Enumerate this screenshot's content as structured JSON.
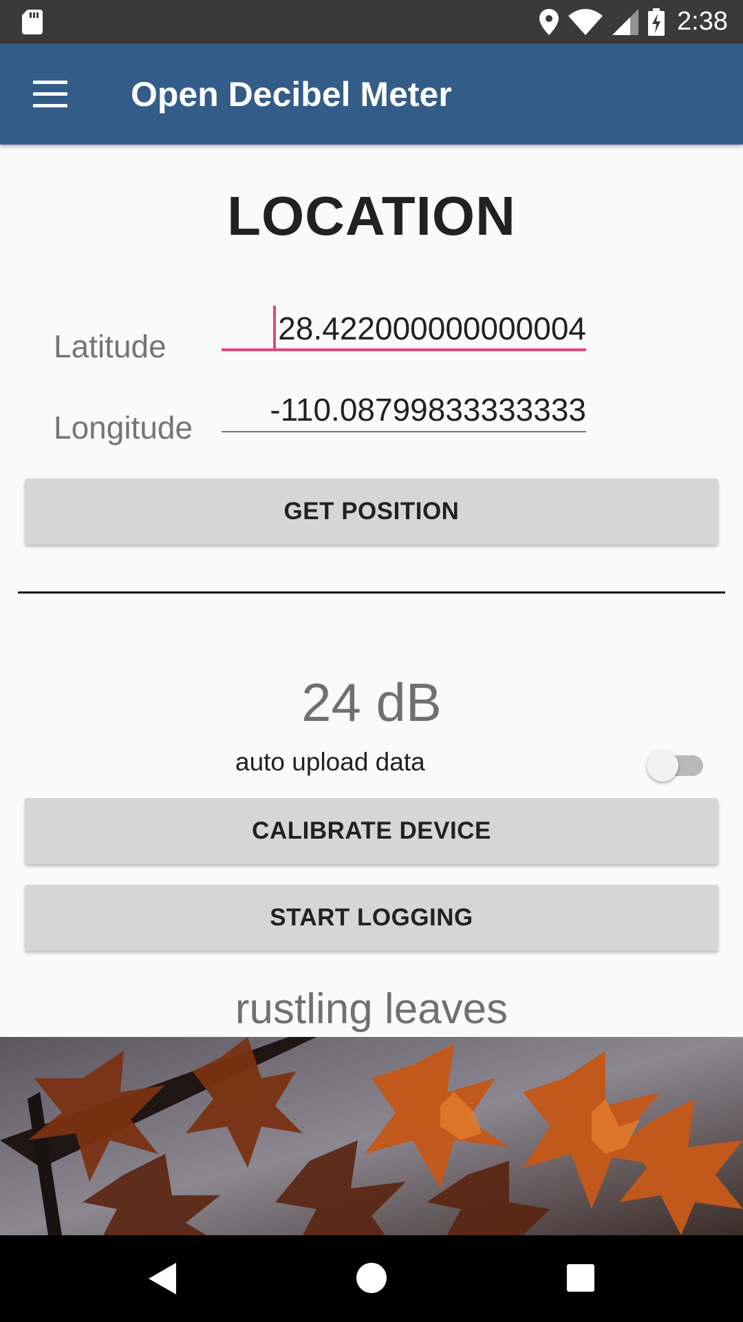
{
  "status_bar": {
    "time": "2:38",
    "icons": [
      "sd-card-icon",
      "location-icon",
      "wifi-icon",
      "signal-icon",
      "battery-charging-icon"
    ]
  },
  "app_bar": {
    "title": "Open Decibel Meter",
    "menu_icon": "menu-icon"
  },
  "location": {
    "title": "LOCATION",
    "latitude_label": "Latitude",
    "latitude_value": "28.422000000000004",
    "longitude_label": "Longitude",
    "longitude_value": "-110.08799833333333",
    "get_position_label": "GET POSITION"
  },
  "meter": {
    "reading": "24 dB",
    "auto_upload_label": "auto upload data",
    "auto_upload_enabled": false,
    "calibrate_label": "CALIBRATE DEVICE",
    "start_logging_label": "START LOGGING",
    "sound_name": "rustling leaves"
  },
  "colors": {
    "app_bar": "#335c88",
    "status_bar": "#3a3a3a",
    "accent": "#e8447e",
    "button": "#d6d6d6"
  },
  "nav_bar": {
    "icons": [
      "back-icon",
      "home-icon",
      "recents-icon"
    ]
  }
}
